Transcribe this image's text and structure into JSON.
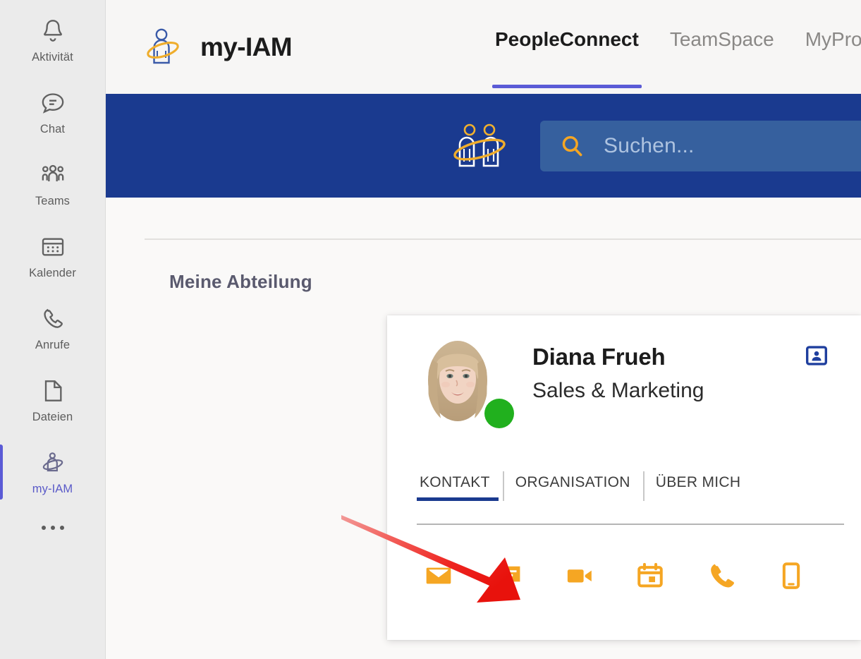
{
  "sidebar": {
    "items": [
      {
        "label": "Aktivität",
        "icon": "bell-icon",
        "active": false
      },
      {
        "label": "Chat",
        "icon": "chat-bubble-icon",
        "active": false
      },
      {
        "label": "Teams",
        "icon": "people-group-icon",
        "active": false
      },
      {
        "label": "Kalender",
        "icon": "calendar-icon",
        "active": false
      },
      {
        "label": "Anrufe",
        "icon": "phone-icon",
        "active": false
      },
      {
        "label": "Dateien",
        "icon": "file-icon",
        "active": false
      },
      {
        "label": "my-IAM",
        "icon": "my-iam-person-orbit-icon",
        "active": true
      }
    ],
    "more_label": "more-options"
  },
  "header": {
    "brand_name": "my-IAM",
    "brand_logo_icon": "person-orbit-logo-icon",
    "tabs": [
      {
        "label": "PeopleConnect",
        "active": true
      },
      {
        "label": "TeamSpace",
        "active": false
      },
      {
        "label": "MyPro",
        "active": false
      }
    ]
  },
  "search_band": {
    "logo_icon": "two-people-orbit-icon",
    "search_icon": "magnifier-icon",
    "placeholder": "Suchen...",
    "value": "",
    "background_color": "#1a3a8f",
    "input_background_color": "#36609e"
  },
  "content": {
    "section_title": "Meine Abteilung"
  },
  "profile_card": {
    "name": "Diana Frueh",
    "department": "Sales & Marketing",
    "presence": "available",
    "presence_color": "#21b01e",
    "badge_icon": "contact-card-icon",
    "avatar_icon": "user-photo",
    "tabs": [
      {
        "label": "KONTAKT",
        "active": true
      },
      {
        "label": "ORGANISATION",
        "active": false
      },
      {
        "label": "ÜBER MICH",
        "active": false
      }
    ],
    "tab_accent_color": "#1a3a8f",
    "actions": [
      {
        "name": "email",
        "icon": "mail-icon"
      },
      {
        "name": "chat",
        "icon": "chat-icon"
      },
      {
        "name": "video-call",
        "icon": "video-camera-icon"
      },
      {
        "name": "schedule-meeting",
        "icon": "calendar-icon"
      },
      {
        "name": "call",
        "icon": "phone-icon"
      },
      {
        "name": "mobile-call",
        "icon": "mobile-phone-icon"
      }
    ],
    "action_color": "#f5a623"
  },
  "annotation": {
    "arrow_color": "#ee1c1c",
    "points_to": "email-action-button"
  }
}
